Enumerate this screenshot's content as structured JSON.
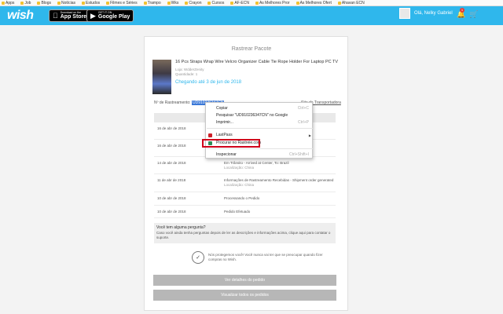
{
  "bookmarks": [
    "Apps",
    "Job",
    "Blogs",
    "Notícias",
    "Estudos",
    "Filmes e Séries",
    "Trampo",
    "Wks",
    "Crayon",
    "Cursos",
    "AF-ECN",
    "As Melhores Pror",
    "As Melhores Ofert",
    "Ahavan ECN"
  ],
  "header": {
    "logo": "wish",
    "appstore_small": "Download on the",
    "appstore_big": "App Store",
    "googleplay_small": "GET IT ON",
    "googleplay_big": "Google Play",
    "user_name": "Olá, Nelky Gabriel",
    "notif_count": "1",
    "colors": {
      "header_bg": "#2fb7ec",
      "accent": "#2fb7ec",
      "highlight": "#d0021b"
    }
  },
  "page": {
    "title": "Rastrear Pacote",
    "product_title": "16 Pcs Straps Wrap Wire Velcro Organizer Cable Tie Rope Holder For Laptop PC TV",
    "seller": "Loja: WdderZenity",
    "quantity": "Quantidade: 1",
    "arrival": "Chegando até 3 de jun de 2018",
    "tracking_label": "Nº de Rastreamento:",
    "tracking_number": "UD910236347CN",
    "carrier_link": "Site da Transportadora",
    "events": [
      {
        "date": "16 de abr de 2018",
        "event": "",
        "location": ""
      },
      {
        "date": "16 de abr de 2018",
        "event": "",
        "location": ""
      },
      {
        "date": "16 de abr de 2018",
        "event": "",
        "location": ""
      },
      {
        "date": "14 de abr de 2018",
        "event": "Em Trânsito - Arrived at Center, To: Brazil",
        "location": "Localização: China"
      },
      {
        "date": "11 de abr de 2018",
        "event": "Informações de Rastreamento Recebidas - Shipment order generated",
        "location": "Localização: China"
      },
      {
        "date": "10 de abr de 2018",
        "event": "Processando o Pedido",
        "location": ""
      },
      {
        "date": "10 de abr de 2018",
        "event": "Pedido Efetuado",
        "location": ""
      }
    ],
    "question_title": "Você tem alguma pergunta?",
    "question_text": "Caso você ainda tenha perguntas depois de ler as descrições e informações acima, clique aqui para contatar o suporte.",
    "protect_text": "Nós protegemos você! Você nunca vai ter que se preocupar quando fizer compras no Wish.",
    "btn_details": "Ver detalhes do pedido",
    "btn_all_orders": "Visualizar todos os pedidos"
  },
  "context_menu": {
    "copy": "Copiar",
    "copy_sc": "Ctrl+C",
    "search": "Pesquisar \"UD910236347CN\" no Google",
    "print": "Imprimir...",
    "print_sc": "Ctrl+P",
    "lastpass": "LastPass",
    "track": "Procurar no Rastreie.com",
    "inspect": "Inspecionar",
    "inspect_sc": "Ctrl+Shift+I"
  }
}
